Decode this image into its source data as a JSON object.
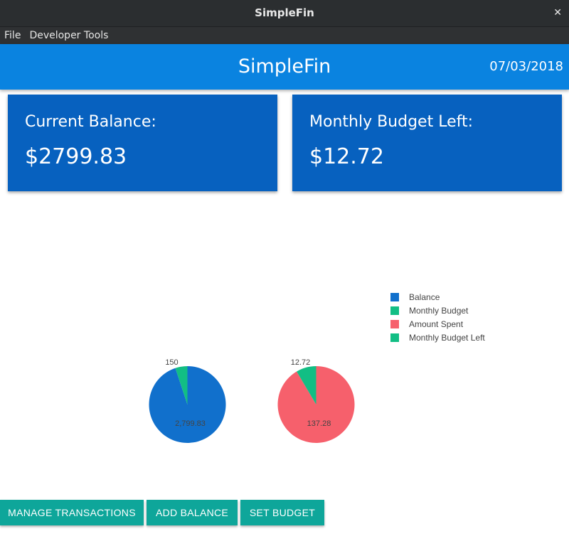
{
  "window": {
    "title": "SimpleFin",
    "close_glyph": "✕"
  },
  "menu": {
    "items": [
      "File",
      "Developer Tools"
    ]
  },
  "header": {
    "title": "SimpleFin",
    "date": "07/03/2018"
  },
  "cards": [
    {
      "label": "Current Balance:",
      "value": "$2799.83"
    },
    {
      "label": "Monthly Budget Left:",
      "value": "$12.72"
    }
  ],
  "chart_data": {
    "type": "pie",
    "legend": [
      "Balance",
      "Monthly Budget",
      "Amount Spent",
      "Monthly Budget Left"
    ],
    "colors": {
      "Balance": "#1170cc",
      "Monthly Budget": "#12be84",
      "Amount Spent": "#f6606c",
      "Monthly Budget Left": "#12be84"
    },
    "pies": [
      {
        "slices": [
          {
            "label": "Balance",
            "value": 2799.83,
            "text": "2,799.83"
          },
          {
            "label": "Monthly Budget",
            "value": 150,
            "text": "150"
          }
        ]
      },
      {
        "slices": [
          {
            "label": "Amount Spent",
            "value": 137.28,
            "text": "137.28"
          },
          {
            "label": "Monthly Budget Left",
            "value": 12.72,
            "text": "12.72"
          }
        ]
      }
    ]
  },
  "buttons": {
    "manage": "MANAGE TRANSACTIONS",
    "add_balance": "ADD BALANCE",
    "set_budget": "SET BUDGET"
  }
}
